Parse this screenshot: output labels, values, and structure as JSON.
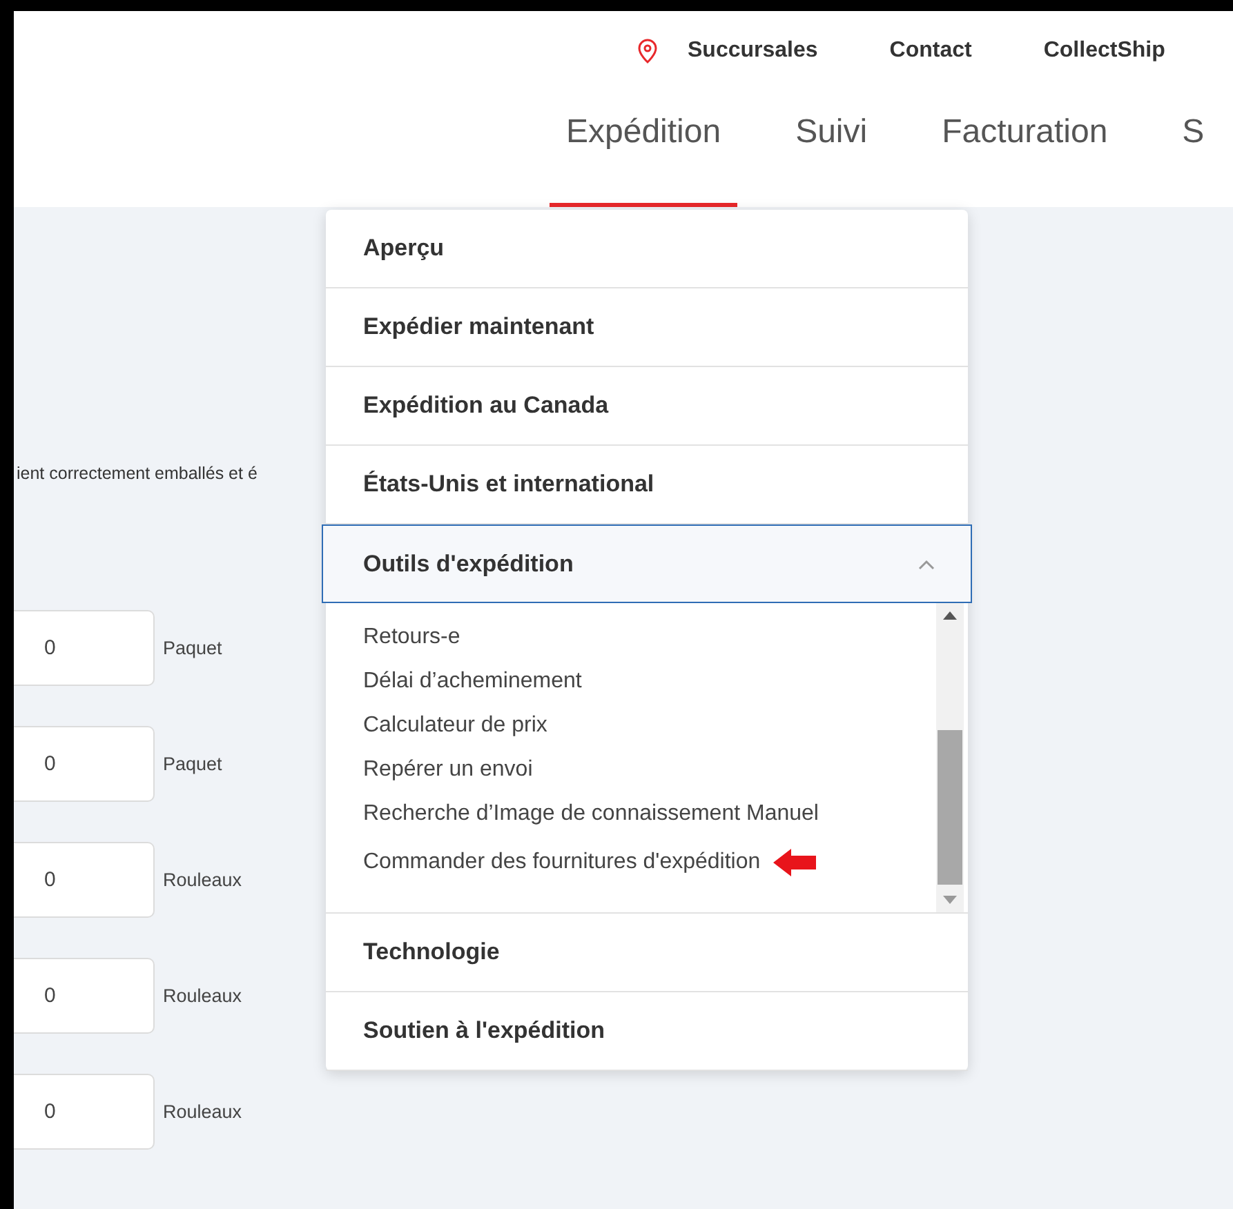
{
  "top_links": [
    {
      "label": "Succursales",
      "kind": "location"
    },
    {
      "label": "Contact",
      "kind": "plain"
    },
    {
      "label": "CollectShip",
      "kind": "plain"
    }
  ],
  "tabs": [
    {
      "label": "Expédition",
      "selected": true
    },
    {
      "label": "Suivi",
      "selected": false
    },
    {
      "label": "Facturation",
      "selected": false
    },
    {
      "label": "S",
      "selected": false
    }
  ],
  "background_text": "ient correctement emballés et é",
  "form_rows": [
    {
      "value": "0",
      "unit": "Paquet"
    },
    {
      "value": "0",
      "unit": "Paquet"
    },
    {
      "value": "0",
      "unit": "Rouleaux"
    },
    {
      "value": "0",
      "unit": "Rouleaux"
    },
    {
      "value": "0",
      "unit": "Rouleaux"
    }
  ],
  "menu": {
    "items": [
      {
        "label": "Aperçu",
        "expanded": false
      },
      {
        "label": "Expédier maintenant",
        "expanded": false
      },
      {
        "label": "Expédition au Canada",
        "expanded": false
      },
      {
        "label": "États-Unis et international",
        "expanded": false
      },
      {
        "label": "Outils d'expédition",
        "expanded": true,
        "children": [
          {
            "label": "Retours-e",
            "annotated": false
          },
          {
            "label": "Délai d’acheminement",
            "annotated": false
          },
          {
            "label": "Calculateur de prix",
            "annotated": false
          },
          {
            "label": "Repérer un envoi",
            "annotated": false
          },
          {
            "label": "Recherche d’Image de connaissement Manuel",
            "annotated": false
          },
          {
            "label": "Commander des fournitures d'expédition",
            "annotated": true
          }
        ]
      },
      {
        "label": "Technologie",
        "expanded": false
      },
      {
        "label": "Soutien à l'expédition",
        "expanded": false
      }
    ]
  }
}
